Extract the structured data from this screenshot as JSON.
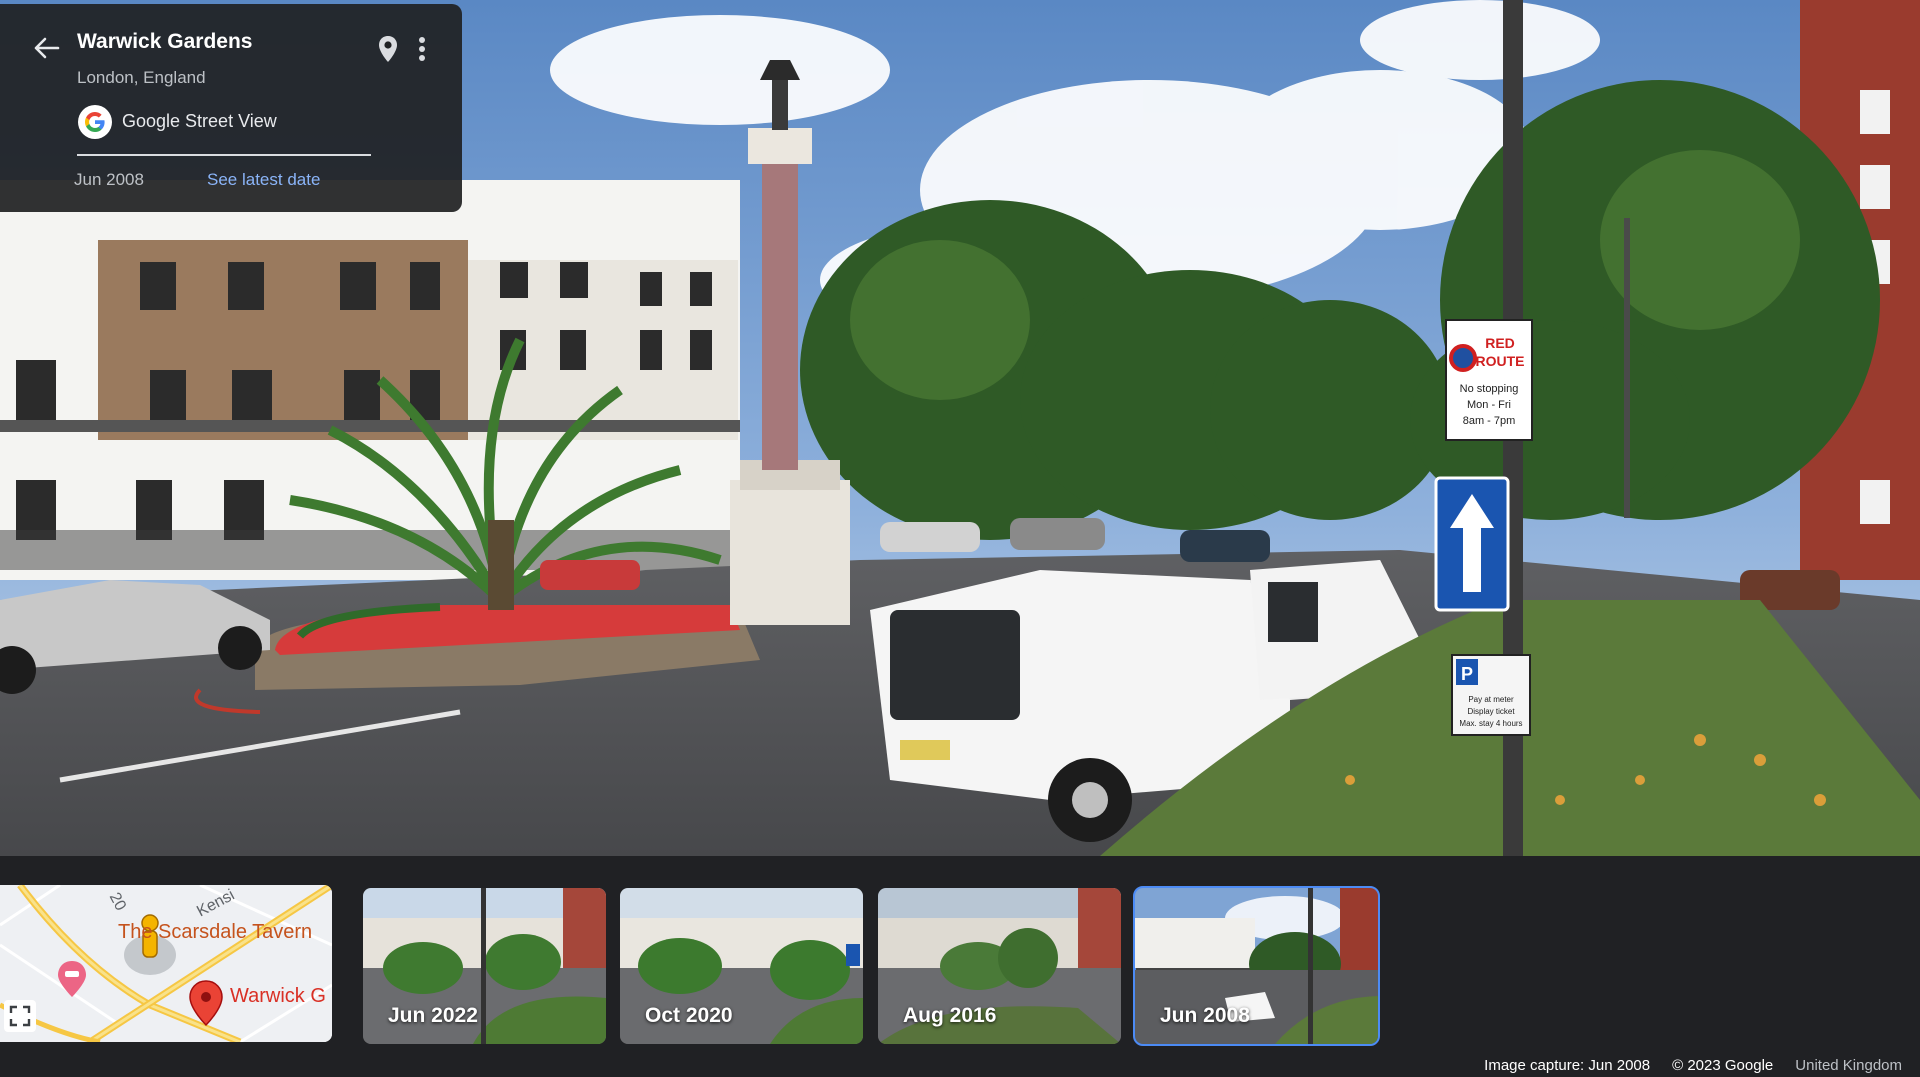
{
  "info": {
    "title": "Warwick Gardens",
    "subtitle": "London, England",
    "provider": "Google Street View",
    "current_date": "Jun 2008",
    "latest_link": "See latest date"
  },
  "map": {
    "road_name": "Kensi",
    "road_number": "20",
    "poi_tavern": "The Scarsdale Tavern",
    "poi_place": "Warwick G"
  },
  "timeline": [
    {
      "label": "Jun 2022",
      "selected": false
    },
    {
      "label": "Oct 2020",
      "selected": false
    },
    {
      "label": "Aug 2016",
      "selected": false
    },
    {
      "label": "Jun 2008",
      "selected": true
    }
  ],
  "footer": {
    "capture": "Image capture: Jun 2008",
    "copyright": "© 2023 Google",
    "region": "United Kingdom"
  },
  "signs": {
    "red_route_1": "RED",
    "red_route_2": "ROUTE",
    "no_stop_1": "No stopping",
    "no_stop_2": "Mon - Fri",
    "no_stop_3": "8am - 7pm",
    "parking_letter": "P",
    "parking_1": "Pay at meter",
    "parking_2": "Display ticket",
    "parking_3": "Max. stay 4 hours"
  },
  "colors": {
    "accent": "#8ab4f8",
    "selected_outline": "#4c8bf5",
    "panel_bg": "#202124"
  }
}
